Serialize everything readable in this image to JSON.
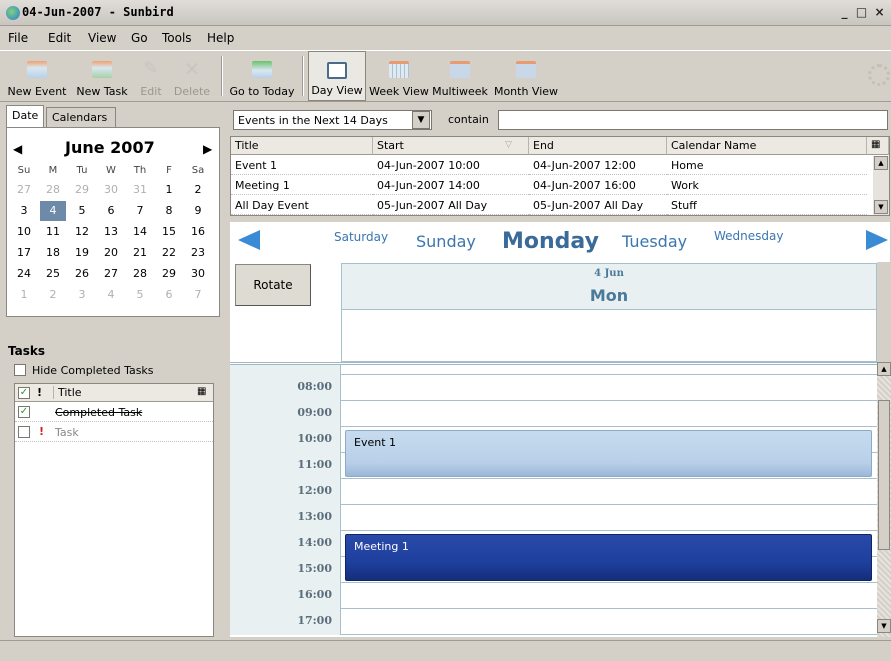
{
  "window": {
    "title": "04-Jun-2007 - Sunbird",
    "buttons": [
      "_",
      "□",
      "×"
    ]
  },
  "menu": [
    "File",
    "Edit",
    "View",
    "Go",
    "Tools",
    "Help"
  ],
  "toolbar": {
    "new_event": "New Event",
    "new_task": "New Task",
    "edit": "Edit",
    "delete": "Delete",
    "go_today": "Go to Today",
    "day_view": "Day View",
    "week_view": "Week View",
    "multiweek": "Multiweek",
    "month_view": "Month View"
  },
  "left_tabs": [
    "Date",
    "Calendars"
  ],
  "minical": {
    "month": "June",
    "year": "2007",
    "dow": [
      "Su",
      "M",
      "Tu",
      "W",
      "Th",
      "F",
      "Sa"
    ],
    "weeks": [
      [
        "27",
        "28",
        "29",
        "30",
        "31",
        "1",
        "2"
      ],
      [
        "3",
        "4",
        "5",
        "6",
        "7",
        "8",
        "9"
      ],
      [
        "10",
        "11",
        "12",
        "13",
        "14",
        "15",
        "16"
      ],
      [
        "17",
        "18",
        "19",
        "20",
        "21",
        "22",
        "23"
      ],
      [
        "24",
        "25",
        "26",
        "27",
        "28",
        "29",
        "30"
      ],
      [
        "1",
        "2",
        "3",
        "4",
        "5",
        "6",
        "7"
      ]
    ],
    "selected": "4"
  },
  "tasks": {
    "label": "Tasks",
    "hide_completed": "Hide Completed Tasks",
    "col_priority": "!",
    "col_title": "Title",
    "items": [
      {
        "title": "Completed Task",
        "done": true,
        "priority": ""
      },
      {
        "title": "Task",
        "done": false,
        "priority": "!"
      }
    ]
  },
  "filter": {
    "selected": "Events in the Next 14 Days",
    "contain_label": "contain",
    "search_value": ""
  },
  "events_table": {
    "columns": [
      "Title",
      "Start",
      "End",
      "Calendar Name"
    ],
    "rows": [
      [
        "Event 1",
        "04-Jun-2007 10:00",
        "04-Jun-2007 12:00",
        "Home"
      ],
      [
        "Meeting 1",
        "04-Jun-2007 14:00",
        "04-Jun-2007 16:00",
        "Work"
      ],
      [
        "All Day Event",
        "05-Jun-2007 All Day",
        "05-Jun-2007 All Day",
        "Stuff"
      ]
    ]
  },
  "day_nav": {
    "days": [
      "Saturday",
      "Sunday",
      "Monday",
      "Tuesday",
      "Wednesday"
    ],
    "current": "Monday"
  },
  "rotate_label": "Rotate",
  "day_header": {
    "date": "4 Jun",
    "day": "Mon"
  },
  "time_slots": [
    "08:00",
    "09:00",
    "10:00",
    "11:00",
    "12:00",
    "13:00",
    "14:00",
    "15:00",
    "16:00",
    "17:00"
  ],
  "events": [
    {
      "title": "Event 1",
      "start": "10:00",
      "end": "12:00",
      "color": "#b9d0e8"
    },
    {
      "title": "Meeting 1",
      "start": "14:00",
      "end": "16:00",
      "color": "#1f3f9f"
    }
  ]
}
